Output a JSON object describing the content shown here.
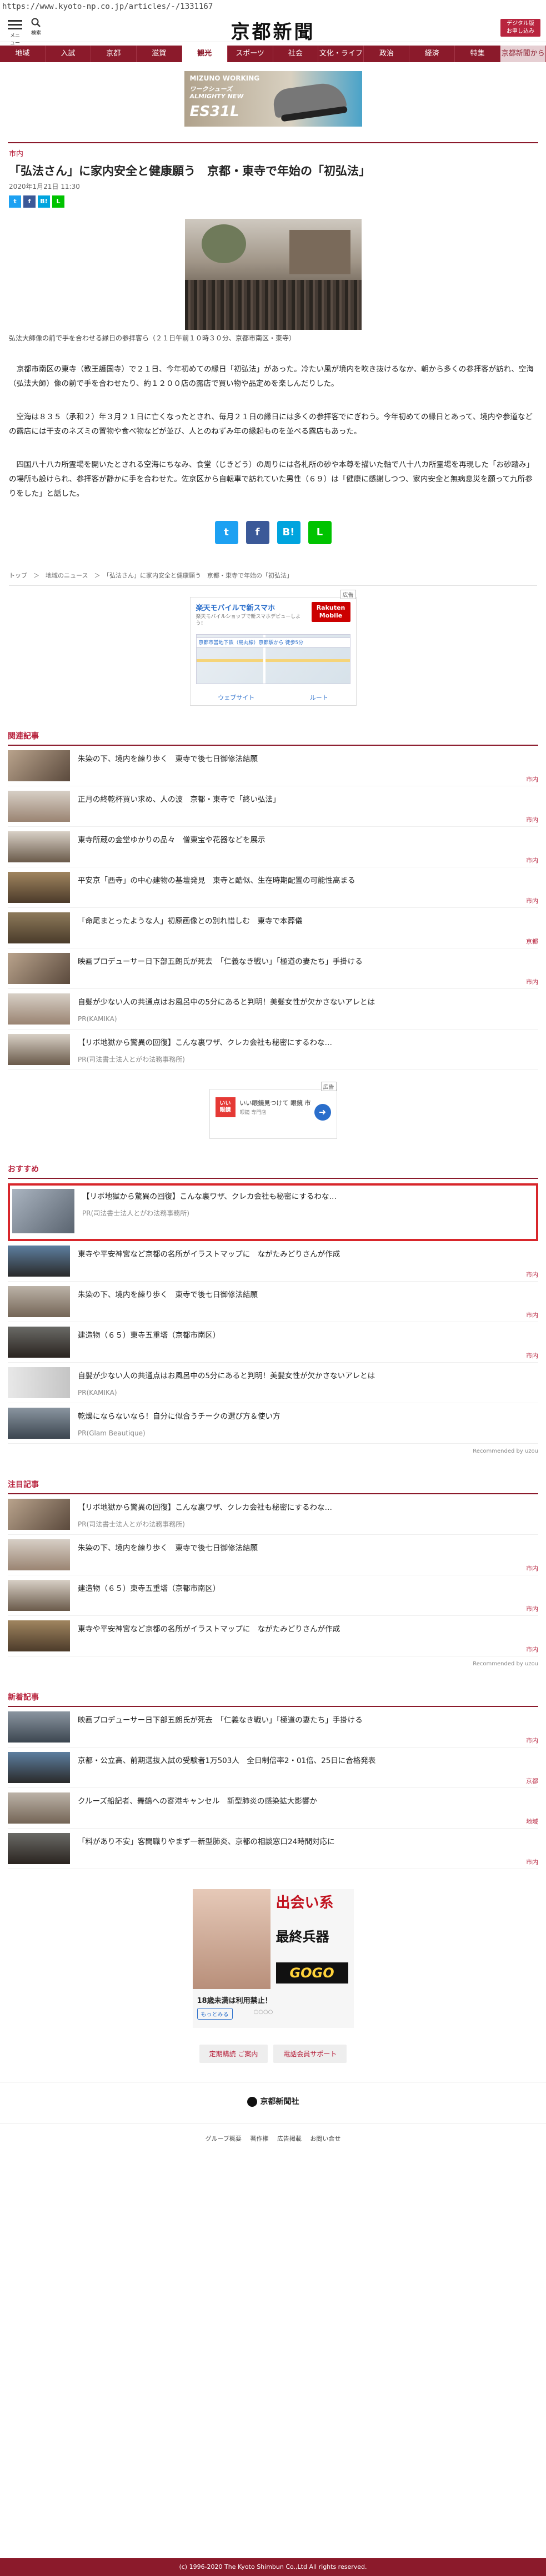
{
  "browser": {
    "url": "https://www.kyoto-np.co.jp/articles/-/1331167"
  },
  "header": {
    "menu_label": "メニュー",
    "search_label": "検索",
    "logo": "京都新聞",
    "digital_btn": "デジタル版\nお申し込み"
  },
  "nav": [
    "地域",
    "入試",
    "京都",
    "滋賀",
    "観光",
    "スポーツ",
    "社会",
    "文化・ライフ",
    "政治",
    "経済",
    "特集",
    "京都新聞から"
  ],
  "nav_active": "観光",
  "ad_top": {
    "brand": "MIZUNO WORKING",
    "sub": "ワークシューズ\nALMIGHTY NEW",
    "model": "ES31L"
  },
  "article": {
    "category": "市内",
    "title": "「弘法さん」に家内安全と健康願う　京都・東寺で年始の「初弘法」",
    "date": "2020年1月21日 11:30",
    "share_small": [
      "t",
      "f",
      "B!",
      "L"
    ],
    "caption": "弘法大師像の前で手を合わせる縁日の参拝客ら（２１日午前１０時３０分、京都市南区・東寺）",
    "paragraphs": [
      "京都市南区の東寺（教王護国寺）で２１日、今年初めての縁日「初弘法」があった。冷たい風が境内を吹き抜けるなか、朝から多くの参拝客が訪れ、空海（弘法大師）像の前で手を合わせたり、約１２００店の露店で買い物や品定めを楽しんだりした。",
      "空海は８３５（承和２）年３月２１日に亡くなったとされ、毎月２１日の縁日には多くの参拝客でにぎわう。今年初めての縁日とあって、境内や参道などの露店には干支のネズミの置物や食べ物などが並び、人とのねずみ年の縁起ものを並べる露店もあった。",
      "四国八十八カ所霊場を開いたとされる空海にちなみ、食堂（じきどう）の周りには各札所の砂や本尊を描いた軸で八十八カ所霊場を再現した「お砂踏み」の場所も設けられ、参拝客が静かに手を合わせた。佐京区から自転車で訪れていた男性（６９）は「健康に感謝しつつ、家内安全と無病息災を願って九所参りをした」と話した。"
    ],
    "share_big": [
      "t",
      "f",
      "B!",
      "L"
    ],
    "breadcrumb": "トップ　＞　地域のニュース　＞　「弘法さん」に家内安全と健康願う　京都・東寺で年始の「初弘法」"
  },
  "map_ad": {
    "ad": "広告",
    "title": "楽天モバイルで新スマホ",
    "sub": "楽天モバイルショップで新スマホデビューしよう！",
    "badge": "Rakuten\nMobile",
    "bar": "京都市営地下鉄（烏丸線）京都駅から 徒歩5分",
    "btn1": "ウェブサイト",
    "btn2": "ルート"
  },
  "related": {
    "heading": "関連記事",
    "items": [
      {
        "title": "朱染の下、境内を練り歩く　東寺で後七日御修法結願",
        "tag": "市内"
      },
      {
        "title": "正月の終乾杯買い求め、人の波　京都・東寺で「終い弘法」",
        "tag": "市内"
      },
      {
        "title": "東寺所蔵の金堂ゆかりの品々　僧東宝や花器などを展示",
        "tag": "市内"
      },
      {
        "title": "平安京「西寺」の中心建物の基壇発見　東寺と酷似、生在時期配置の可能性高まる",
        "tag": "市内"
      },
      {
        "title": "「命尾まとったような人」初原画像との別れ惜しむ　東寺で本葬儀",
        "tag": "京都"
      },
      {
        "title": "映画プロデューサー日下部五朗氏が死去　「仁義なき戦い」「極道の妻たち」手掛ける",
        "tag": "市内"
      },
      {
        "title": "自髪が少ない人の共通点はお風呂中の5分にあると判明！美髪女性が欠かさないアレとは",
        "pr": "PR(KAMIKA)"
      },
      {
        "title": "【リボ地獄から驚異の回復】こんな裏ワザ、クレカ会社も秘密にするわな…",
        "pr": "PR(司法書士法人とがわ法務事務所)"
      }
    ]
  },
  "small_ad": {
    "ad": "広告",
    "logo": "いい\n眼鏡",
    "title": "いい眼鏡見つけて 眼鏡 市",
    "sub": "眼鏡 専門店",
    "go": "➜"
  },
  "recommend": {
    "heading": "おすすめ",
    "highlight": {
      "title": "【リボ地獄から驚異の回復】こんな裏ワザ、クレカ会社も秘密にするわな…",
      "pr": "PR(司法書士法人とがわ法務事務所)"
    },
    "items": [
      {
        "title": "東寺や平安神宮など京都の名所がイラストマップに　ながたみどりさんが作成",
        "tag": "市内"
      },
      {
        "title": "朱染の下、境内を練り歩く　東寺で後七日御修法結願",
        "tag": "市内"
      },
      {
        "title": "建造物（６５）東寺五重塔（京都市南区）",
        "tag": "市内"
      },
      {
        "title": "自髪が少ない人の共通点はお風呂中の5分にあると判明！美髪女性が欠かさないアレとは",
        "pr": "PR(KAMIKA)"
      },
      {
        "title": "乾燥にならないなら！自分に似合うチークの選び方＆使い方",
        "pr": "PR(Glam Beautique)"
      }
    ],
    "powered": "Recommended by uzou"
  },
  "popular": {
    "heading": "注目記事",
    "items": [
      {
        "title": "【リボ地獄から驚異の回復】こんな裏ワザ、クレカ会社も秘密にするわな…",
        "pr": "PR(司法書士法人とがわ法務事務所)"
      },
      {
        "title": "朱染の下、境内を練り歩く　東寺で後七日御修法結願",
        "tag": "市内"
      },
      {
        "title": "建造物（６５）東寺五重塔（京都市南区）",
        "tag": "市内"
      },
      {
        "title": "東寺や平安神宮など京都の名所がイラストマップに　ながたみどりさんが作成",
        "tag": "市内"
      }
    ],
    "powered": "Recommended by uzou"
  },
  "latest": {
    "heading": "新着記事",
    "items": [
      {
        "title": "映画プロデューサー日下部五朗氏が死去　「仁義なき戦い」「極道の妻たち」手掛ける",
        "tag": "市内"
      },
      {
        "title": "京都・公立高、前期選抜入試の受験者1万503人　全日制倍率2・01倍、25日に合格発表",
        "tag": "京都"
      },
      {
        "title": "クルーズ船記者、舞鶴への寄港キャンセル　新型肺炎の感染拡大影響か",
        "tag": "地域"
      },
      {
        "title": "「料があり不安」客間職りやまず一新型肺炎、京都の相談窓口24時間対応に",
        "tag": "市内"
      }
    ]
  },
  "big_ad": {
    "c1": "出会い系",
    "c2": "最終兵器",
    "c3": "GOGO",
    "c4": "18歳未満は利用禁止！",
    "c5": "もっとみる",
    "c6": "○○○○"
  },
  "footer": {
    "btn1": "定期購読 ご案内",
    "btn2": "電話会員サポート",
    "company": "京都新聞社",
    "links": [
      "グループ概要",
      "著作権",
      "広告掲載",
      "お問い合せ"
    ],
    "copyright": "(c) 1996-2020 The Kyoto Shimbun Co.,Ltd All rights reserved."
  },
  "colors": {
    "brand": "#8b1a2b",
    "accent": "#b8243e",
    "highlight_border": "#d8262b"
  }
}
